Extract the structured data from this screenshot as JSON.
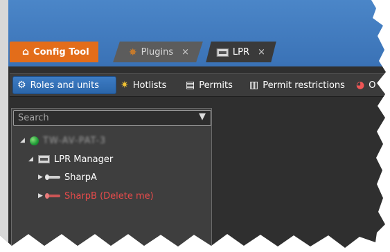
{
  "tabs": [
    {
      "label": "Config Tool",
      "icon": "home-icon"
    },
    {
      "label": "Plugins",
      "icon": "plugin-star-icon",
      "close": "×"
    },
    {
      "label": "LPR",
      "icon": "lpr-plate-icon",
      "close": "×"
    }
  ],
  "toolbar": {
    "items": [
      {
        "label": "Roles and units",
        "icon": "roles-units-icon",
        "active": true
      },
      {
        "label": "Hotlists",
        "icon": "hotlist-star-icon"
      },
      {
        "label": "Permits",
        "icon": "permit-document-icon"
      },
      {
        "label": "Permit restrictions",
        "icon": "permit-restriction-icon"
      },
      {
        "label": "O",
        "icon": "overtime-icon"
      }
    ]
  },
  "search": {
    "placeholder": "Search",
    "filter_icon": "funnel-icon"
  },
  "tree": [
    {
      "label": "TW-AV-PAT-3",
      "icon": "globe-icon",
      "level": 0,
      "expanded": true,
      "obscured": true
    },
    {
      "label": "LPR Manager",
      "icon": "lpr-manager-icon",
      "level": 1,
      "expanded": true
    },
    {
      "label": "SharpA",
      "icon": "sharp-camera-icon",
      "level": 2,
      "expanded": false
    },
    {
      "label": "SharpB (Delete me)",
      "icon": "sharp-camera-icon",
      "level": 2,
      "expanded": false,
      "color": "#e84b4b"
    }
  ],
  "colors": {
    "header_blue": "#3a72b6",
    "active_tab_orange": "#e36d1a",
    "active_button_blue": "#2b66aa",
    "panel_dark": "#3e3e3e",
    "deleted_red": "#e84b4b"
  }
}
